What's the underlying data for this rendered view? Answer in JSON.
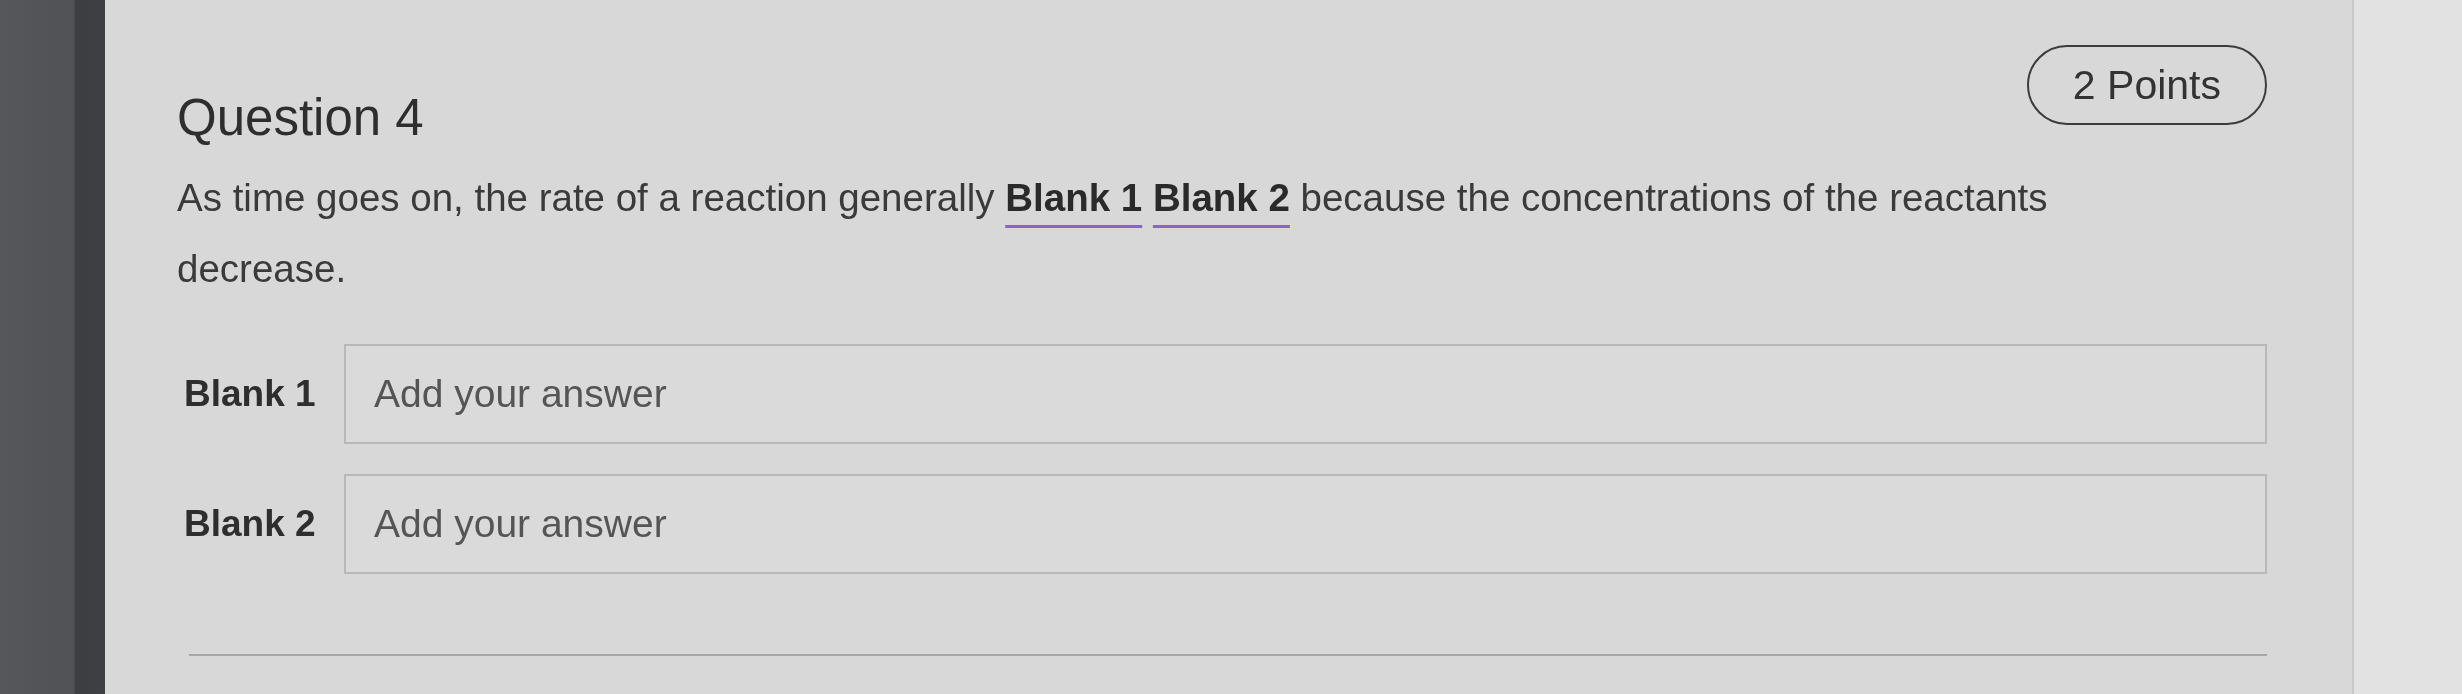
{
  "question": {
    "title": "Question 4",
    "points": "2 Points",
    "text": "As time goes on, the rate of a reaction generally **Blank 1** **Blank 2** because the concentrations of the reactants decrease."
  },
  "blanks": [
    {
      "label": "Blank 1",
      "placeholder": "Add your answer"
    },
    {
      "label": "Blank 2",
      "placeholder": "Add your answer"
    }
  ]
}
